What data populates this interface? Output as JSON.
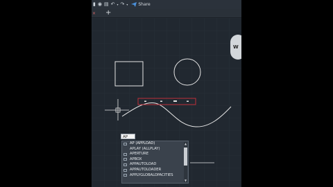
{
  "toolbar": {
    "items": [
      "new-icon",
      "save-icon",
      "undo-icon",
      "redo-icon",
      "share-icon"
    ],
    "share_label": "Share"
  },
  "tabs": {
    "close_glyph": "×",
    "add_glyph": "+"
  },
  "viewcube": {
    "label": "W"
  },
  "command_line": {
    "value": "AP"
  },
  "autocomplete": {
    "items": [
      "AP (APPLOAD)",
      "APLAY (ALLPLAY)",
      "APERTURE",
      "APBOX",
      "APPAUTOLOAD",
      "APPAUTOLOADER",
      "APPLYGLOBALOPACITIES"
    ]
  },
  "colors": {
    "canvas_bg": "#212830",
    "drawing_stroke": "#e6e6e6",
    "selection_box": "#c0303a",
    "pillarbox": "#000000"
  }
}
